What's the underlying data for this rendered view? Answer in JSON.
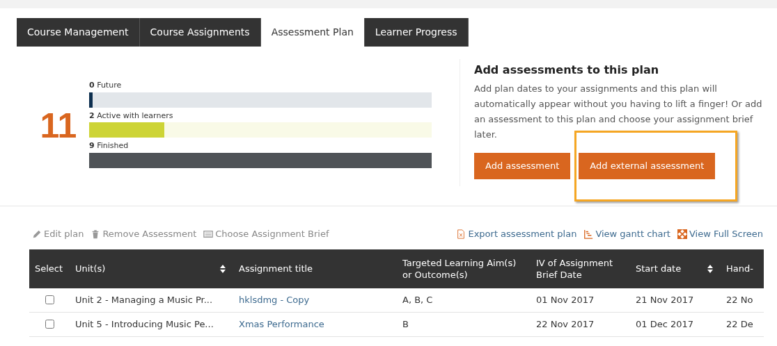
{
  "tabs": [
    {
      "label": "Course Management",
      "selected": false
    },
    {
      "label": "Course Assignments",
      "selected": false
    },
    {
      "label": "Assessment Plan",
      "selected": true
    },
    {
      "label": "Learner Progress",
      "selected": false
    }
  ],
  "summary": {
    "total": "11",
    "stats": [
      {
        "count": "0",
        "label": "Future",
        "level": 0,
        "color": "#0d2f4f"
      },
      {
        "count": "2",
        "label": "Active with learners",
        "level": 0.22,
        "color": "#cdd436"
      },
      {
        "count": "9",
        "label": "Finished",
        "level": 1,
        "color": "#4f5357"
      }
    ]
  },
  "add_panel": {
    "title": "Add assessments to this plan",
    "text": "Add plan dates to your assignments and this plan will automatically appear without you having to lift a finger! Or add an assessment to this plan and choose your assignment brief later.",
    "buttons": [
      {
        "label": "Add assessment",
        "highlighted": false
      },
      {
        "label": "Add external assessment",
        "highlighted": true
      }
    ]
  },
  "toolbar": {
    "left": [
      {
        "kind": "edit",
        "label": "Edit plan"
      },
      {
        "kind": "trash",
        "label": "Remove Assessment"
      },
      {
        "kind": "brief",
        "label": "Choose Assignment Brief"
      }
    ],
    "right": [
      {
        "kind": "export",
        "label": "Export assessment plan"
      },
      {
        "kind": "gantt",
        "label": "View gantt chart"
      },
      {
        "kind": "fullscreen",
        "label": "View Full Screen"
      }
    ]
  },
  "table": {
    "columns": [
      {
        "label": "Select",
        "sortable": false
      },
      {
        "label": "Unit(s)",
        "sortable": true
      },
      {
        "label": "Assignment title",
        "sortable": false
      },
      {
        "label": "Targeted Learning Aim(s) or Outcome(s)",
        "sortable": false
      },
      {
        "label": "IV of Assignment Brief Date",
        "sortable": false
      },
      {
        "label": "Start date",
        "sortable": true
      },
      {
        "label": "Hand-",
        "sortable": false
      }
    ],
    "rows": [
      {
        "checked": false,
        "unit": "Unit 2 - Managing a Music Pr...",
        "title": "hklsdmg - Copy",
        "aims": "A, B, C",
        "iv_date": "01 Nov 2017",
        "start_date": "21 Nov 2017",
        "hand_in": "22 No"
      },
      {
        "checked": false,
        "unit": "Unit 5 - Introducing Music Pe...",
        "title": "Xmas Performance",
        "aims": "B",
        "iv_date": "22 Nov 2017",
        "start_date": "01 Dec 2017",
        "hand_in": "22 De"
      }
    ]
  }
}
